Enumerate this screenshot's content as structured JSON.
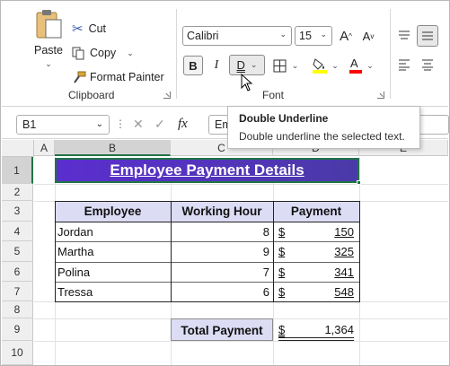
{
  "ribbon": {
    "clipboard": {
      "paste_label": "Paste",
      "cut_label": "Cut",
      "copy_label": "Copy",
      "format_painter_label": "Format Painter",
      "group_label": "Clipboard"
    },
    "font": {
      "font_name": "Calibri",
      "font_size": "15",
      "bold_label": "B",
      "italic_label": "I",
      "underline_label": "D",
      "increase_size_label": "A",
      "decrease_size_label": "A",
      "group_label": "Font",
      "fill_color": "#FFFF00",
      "font_color": "#FF0000"
    }
  },
  "formula_bar": {
    "name_box": "B1",
    "fx_label": "fx",
    "formula_text": "Em"
  },
  "tooltip": {
    "title": "Double Underline",
    "description": "Double underline the selected text."
  },
  "sheet": {
    "columns": [
      "A",
      "B",
      "C",
      "D",
      "E"
    ],
    "rows": [
      "1",
      "2",
      "3",
      "4",
      "5",
      "6",
      "7",
      "8",
      "9",
      "10"
    ],
    "title": "Employee Payment Details",
    "title_colors": [
      "#5b2ecf",
      "#4a3aa8"
    ],
    "table_headers": [
      "Employee",
      "Working Hour",
      "Payment"
    ],
    "table_rows": [
      {
        "employee": "Jordan",
        "hours": "8",
        "currency": "$",
        "payment": "150"
      },
      {
        "employee": "Martha",
        "hours": "9",
        "currency": "$",
        "payment": "325"
      },
      {
        "employee": "Polina",
        "hours": "7",
        "currency": "$",
        "payment": "341"
      },
      {
        "employee": "Tressa",
        "hours": "6",
        "currency": "$",
        "payment": "548"
      }
    ],
    "total_label": "Total Payment",
    "total_currency": "$",
    "total_value": "1,364",
    "header_fill": "#DCDCF5"
  }
}
